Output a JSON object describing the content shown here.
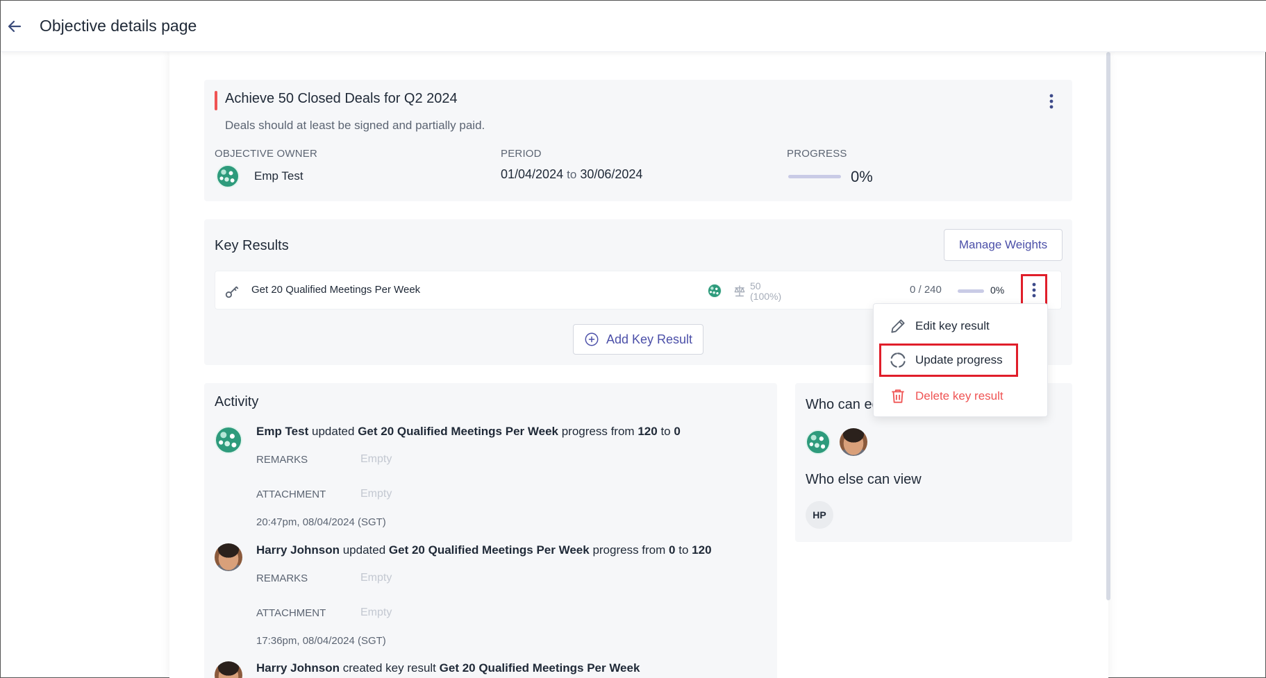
{
  "header": {
    "title": "Objective details page",
    "back_icon": "arrow-left-icon"
  },
  "objective": {
    "title": "Achieve 50 Closed Deals for Q2 2024",
    "description": "Deals should at least be signed and partially paid.",
    "owner_label": "OBJECTIVE OWNER",
    "owner_name": "Emp Test",
    "period_label": "PERIOD",
    "period_start": "01/04/2024",
    "period_to": "to",
    "period_end": "30/06/2024",
    "progress_label": "PROGRESS",
    "progress_value": "0%",
    "progress_fraction": 0,
    "accent_color": "#ef5454"
  },
  "key_results": {
    "heading": "Key Results",
    "manage_weights_label": "Manage Weights",
    "add_label": "Add Key Result",
    "items": [
      {
        "name": "Get 20 Qualified Meetings Per Week",
        "weight": "50",
        "weight_pct": "(100%)",
        "count": "0 / 240",
        "progress": "0%"
      }
    ]
  },
  "menu": {
    "edit": "Edit key result",
    "update": "Update progress",
    "delete": "Delete key result"
  },
  "activity": {
    "heading": "Activity",
    "remarks_label": "REMARKS",
    "attachment_label": "ATTACHMENT",
    "empty_text": "Empty",
    "items": [
      {
        "user": "Emp Test",
        "verb": "updated",
        "target": "Get 20 Qualified Meetings Per Week",
        "mid": "progress from",
        "from": "120",
        "to_word": "to",
        "to": "0",
        "time": "20:47pm, 08/04/2024 (SGT)"
      },
      {
        "user": "Harry Johnson",
        "verb": "updated",
        "target": "Get 20 Qualified Meetings Per Week",
        "mid": "progress from",
        "from": "0",
        "to_word": "to",
        "to": "120",
        "time": "17:36pm, 08/04/2024 (SGT)"
      },
      {
        "user": "Harry Johnson",
        "verb": "created key result",
        "target": "Get 20 Qualified Meetings Per Week"
      }
    ]
  },
  "access": {
    "who_can_edit": "Who can edit",
    "who_else_can_view": "Who else can view",
    "viewer_initials": "HP"
  },
  "colors": {
    "brand": "#4b4fa8",
    "danger": "#ef5454",
    "highlight_box": "#e01e2a"
  }
}
